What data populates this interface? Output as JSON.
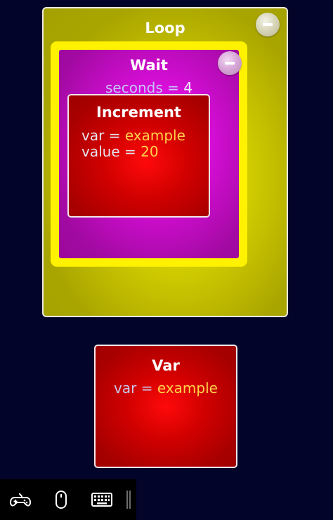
{
  "loop": {
    "title": "Loop"
  },
  "wait": {
    "title": "Wait",
    "param": {
      "key": "seconds",
      "eq": "=",
      "value": "4"
    }
  },
  "increment": {
    "title": "Increment",
    "params": [
      {
        "key": "var",
        "eq": "=",
        "value": "example"
      },
      {
        "key": "value",
        "eq": "=",
        "value": "20"
      }
    ]
  },
  "var_block": {
    "title": "Var",
    "param": {
      "key": "var",
      "eq": "=",
      "value": "example"
    }
  },
  "toolbar": {
    "icons": [
      "gamepad-icon",
      "mouse-icon",
      "keyboard-icon"
    ]
  },
  "colors": {
    "background": "#02042a",
    "loop_block": "#cfca00",
    "wait_block": "#d80ed8",
    "selection_ring": "#fff200",
    "increment_block": "#d00000",
    "var_block": "#d00000",
    "value_text": "#ffd24a"
  }
}
